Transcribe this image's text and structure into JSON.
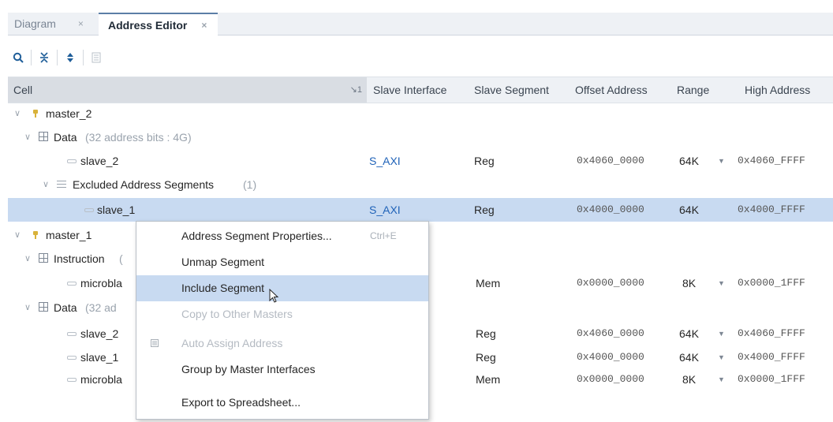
{
  "tabs": [
    {
      "label": "Diagram",
      "close": "×"
    },
    {
      "label": "Address Editor",
      "close": "×"
    }
  ],
  "toolbar": {
    "icons": [
      "search-icon",
      "collapse-all-icon",
      "expand-all-icon",
      "auto-assign-icon"
    ]
  },
  "header": {
    "cell": "Cell",
    "sort_indicator": "↘1",
    "slave_interface": "Slave Interface",
    "slave_segment": "Slave Segment",
    "offset_address": "Offset Address",
    "range": "Range",
    "high_address": "High Address"
  },
  "rows": [
    {
      "type": "master",
      "label": "master_2"
    },
    {
      "type": "space",
      "label": "Data",
      "note": "(32 address bits : 4G)"
    },
    {
      "type": "segment",
      "label": "slave_2",
      "interface": "S_AXI",
      "segment": "Reg",
      "offset": "0x4060_0000",
      "range": "64K",
      "high": "0x4060_FFFF"
    },
    {
      "type": "group",
      "label": "Excluded Address Segments",
      "count": "(1)"
    },
    {
      "type": "segment",
      "label": "slave_1",
      "interface": "S_AXI",
      "segment": "Reg",
      "offset": "0x4000_0000",
      "range": "64K",
      "high": "0x4000_FFFF",
      "selected": true
    },
    {
      "type": "master",
      "label": "master_1"
    },
    {
      "type": "space",
      "label": "Instruction",
      "note": "("
    },
    {
      "type": "segment",
      "label": "microbla",
      "segment": "Mem",
      "offset": "0x0000_0000",
      "range": "8K",
      "high": "0x0000_1FFF"
    },
    {
      "type": "space",
      "label": "Data",
      "note": "(32 ad"
    },
    {
      "type": "segment",
      "label": "slave_2",
      "segment": "Reg",
      "offset": "0x4060_0000",
      "range": "64K",
      "high": "0x4060_FFFF"
    },
    {
      "type": "segment",
      "label": "slave_1",
      "segment": "Reg",
      "offset": "0x4000_0000",
      "range": "64K",
      "high": "0x4000_FFFF"
    },
    {
      "type": "segment",
      "label": "microbla",
      "segment": "Mem",
      "offset": "0x0000_0000",
      "range": "8K",
      "high": "0x0000_1FFF"
    }
  ],
  "context_menu": {
    "items": [
      {
        "label": "Address Segment Properties...",
        "shortcut": "Ctrl+E",
        "enabled": true
      },
      {
        "label": "Unmap Segment",
        "enabled": true
      },
      {
        "label": "Include Segment",
        "enabled": true,
        "highlighted": true
      },
      {
        "label": "Copy to Other Masters",
        "enabled": false
      },
      {
        "label": "Auto Assign Address",
        "enabled": false,
        "icon": "auto-assign-icon"
      },
      {
        "label": "Group by Master Interfaces",
        "enabled": true
      },
      {
        "label": "Export to Spreadsheet...",
        "enabled": true
      }
    ]
  },
  "colors": {
    "selection": "#c8daf1",
    "link": "#1f62b8",
    "pin": "#d9b23a"
  }
}
